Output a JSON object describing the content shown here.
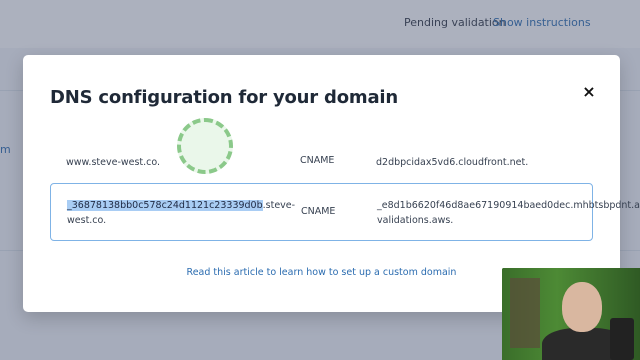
{
  "background": {
    "status_text": "Pending validation",
    "show_instructions_label": "Show instructions",
    "left_link_fragment": "m"
  },
  "modal": {
    "title": "DNS configuration for your domain",
    "close_icon": "×",
    "records": [
      {
        "name": "www.steve-west.co.",
        "type": "CNAME",
        "value": "d2dbpcidax5vd6.cloudfront.net."
      },
      {
        "name_selected": "_36878138bb0c578c24d1121c23339d0b",
        "name_rest": ".steve-west.co.",
        "type": "CNAME",
        "value": "_e8d1b6620f46d8ae67190914baed0dec.mhbtsbpdnt.acm-validations.aws."
      }
    ],
    "help_link": "Read this article to learn how to set up a custom domain"
  },
  "colors": {
    "accent_link": "#2b6cb0",
    "selection": "#a9cdf4",
    "row_highlight_border": "#7fb3e6",
    "click_indicator": "#8bc98a"
  }
}
